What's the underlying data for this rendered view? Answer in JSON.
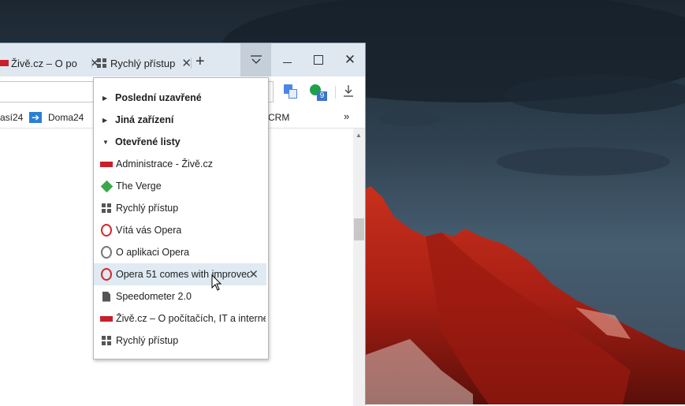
{
  "browser": {
    "tabs": [
      {
        "title": "Živě.cz – O po",
        "favicon": "zive-favicon"
      },
      {
        "title": "Rychlý přístup",
        "favicon": "speed-dial-icon"
      }
    ],
    "new_tab_label": "+",
    "bookmarks": [
      {
        "label": "así24"
      },
      {
        "label": "Doma24"
      },
      {
        "label": "CRM"
      }
    ],
    "bookmarks_overflow": "»",
    "extension_badge": "9"
  },
  "tab_menu": {
    "sections": [
      {
        "label": "Poslední uzavřené",
        "expanded": false
      },
      {
        "label": "Jiná zařízení",
        "expanded": false
      },
      {
        "label": "Otevřené listy",
        "expanded": true
      }
    ],
    "open_tabs": [
      {
        "label": "Administrace - Živě.cz",
        "icon": "zive-favicon"
      },
      {
        "label": "The Verge",
        "icon": "verge-icon"
      },
      {
        "label": "Rychlý přístup",
        "icon": "speed-dial-icon"
      },
      {
        "label": "Vítá vás Opera",
        "icon": "opera-icon"
      },
      {
        "label": "O aplikaci Opera",
        "icon": "opera-gray-icon"
      },
      {
        "label": "Opera 51 comes with improved",
        "icon": "opera-icon",
        "hovered": true
      },
      {
        "label": "Speedometer 2.0",
        "icon": "document-icon"
      },
      {
        "label": "Živě.cz – O počítačích, IT a internetu",
        "icon": "zive-favicon"
      },
      {
        "label": "Rychlý přístup",
        "icon": "speed-dial-icon"
      }
    ]
  },
  "colors": {
    "tabbar": "#dfe8f1",
    "menu_highlight": "#dfeaf3",
    "opera_red": "#d7262c",
    "zive_red": "#c8202a",
    "verge_green": "#3ca84a"
  }
}
